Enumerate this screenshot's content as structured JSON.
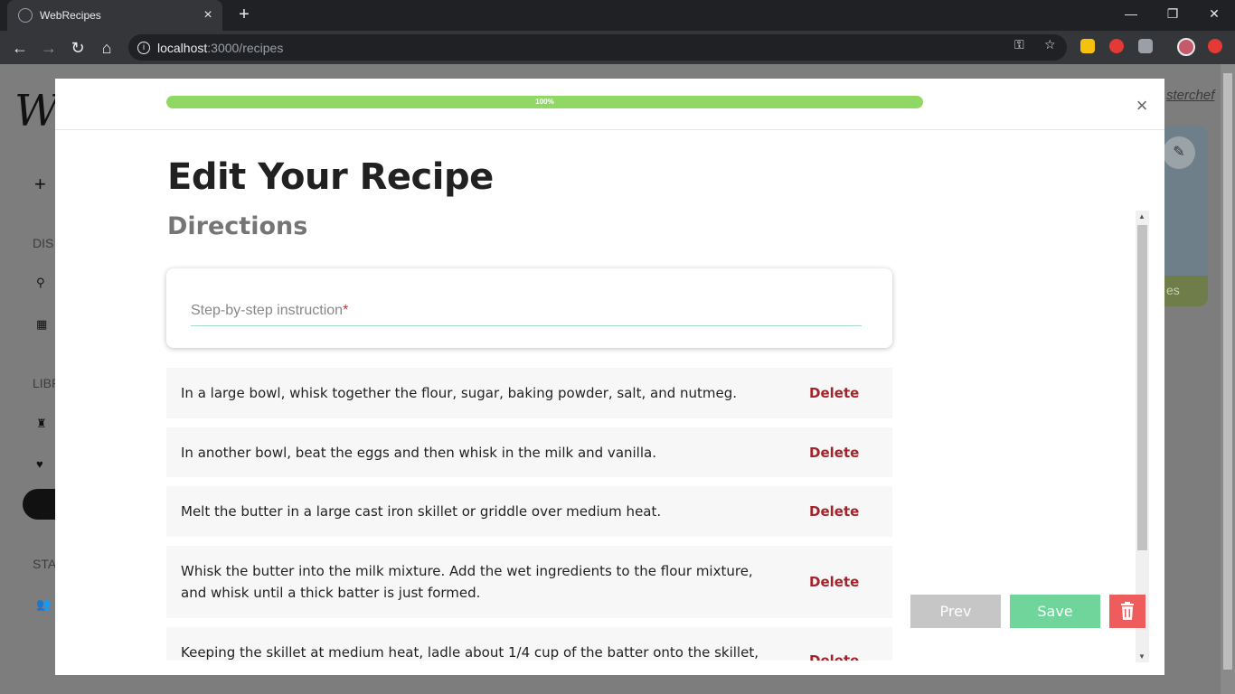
{
  "browser": {
    "tab_title": "WebRecipes",
    "url_host": "localhost",
    "url_path": ":3000/recipes"
  },
  "background": {
    "logo": "We",
    "user_link": "sterchef",
    "side_headings": [
      "DIS",
      "LIBR",
      "STA"
    ],
    "card_label": "es"
  },
  "modal": {
    "progress_value": 100,
    "progress_label": "100%",
    "title": "Edit Your Recipe",
    "section": "Directions",
    "input_placeholder": "Step-by-step instruction",
    "required_marker": "*",
    "steps": [
      {
        "text": "In a large bowl, whisk together the flour, sugar, baking powder, salt, and nutmeg.",
        "action": "Delete"
      },
      {
        "text": "In another bowl, beat the eggs and then whisk in the milk and vanilla.",
        "action": "Delete"
      },
      {
        "text": "Melt the butter in a large cast iron skillet or griddle over medium heat.",
        "action": "Delete"
      },
      {
        "text": "Whisk the butter into the milk mixture. Add the wet ingredients to the flour mixture, and whisk until a thick batter is just formed.",
        "action": "Delete"
      },
      {
        "text": "Keeping the skillet at medium heat, ladle about 1/4 cup of the batter onto the skillet, to",
        "action": "Delete"
      }
    ],
    "buttons": {
      "prev": "Prev",
      "save": "Save"
    }
  },
  "colors": {
    "progress": "#8fd863",
    "save": "#6fd59a",
    "trash": "#ef5c5c",
    "delete": "#a3232a"
  }
}
